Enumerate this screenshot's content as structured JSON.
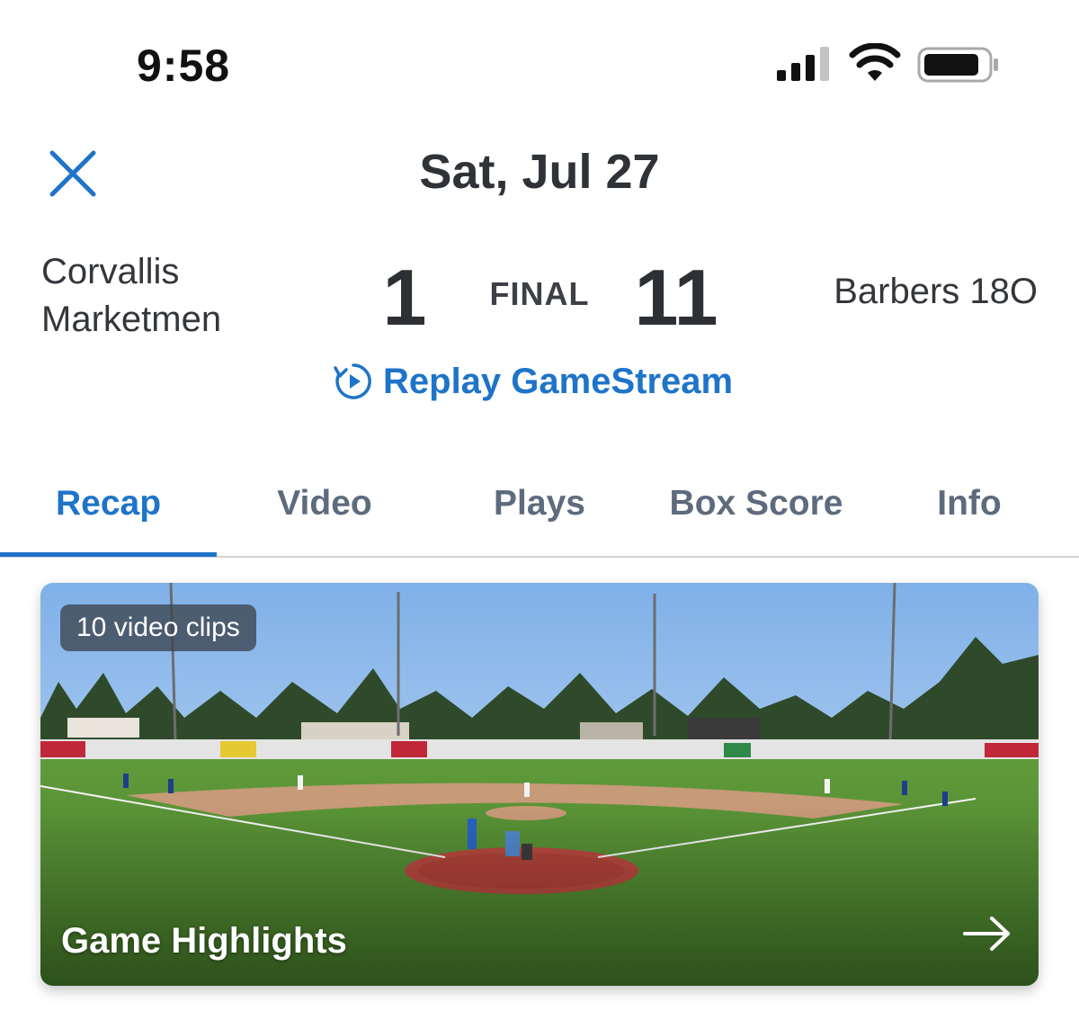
{
  "status_bar": {
    "time": "9:58"
  },
  "header": {
    "title": "Sat, Jul 27"
  },
  "game": {
    "away_team": "Corvallis\nMarketmen",
    "away_score": "1",
    "status": "FINAL",
    "home_score": "11",
    "home_team": "Barbers 18O",
    "replay_label": "Replay GameStream"
  },
  "tabs": [
    {
      "label": "Recap",
      "active": true
    },
    {
      "label": "Video",
      "active": false
    },
    {
      "label": "Plays",
      "active": false
    },
    {
      "label": "Box Score",
      "active": false
    },
    {
      "label": "Info",
      "active": false
    }
  ],
  "highlight_card": {
    "badge": "10 video clips",
    "title": "Game Highlights"
  },
  "colors": {
    "accent": "#1e74c8",
    "tab_inactive": "#5d6b7d",
    "text": "#2f3237"
  },
  "icons": [
    "close-icon",
    "replay-icon",
    "signal-icon",
    "wifi-icon",
    "battery-icon",
    "arrow-right-icon"
  ]
}
